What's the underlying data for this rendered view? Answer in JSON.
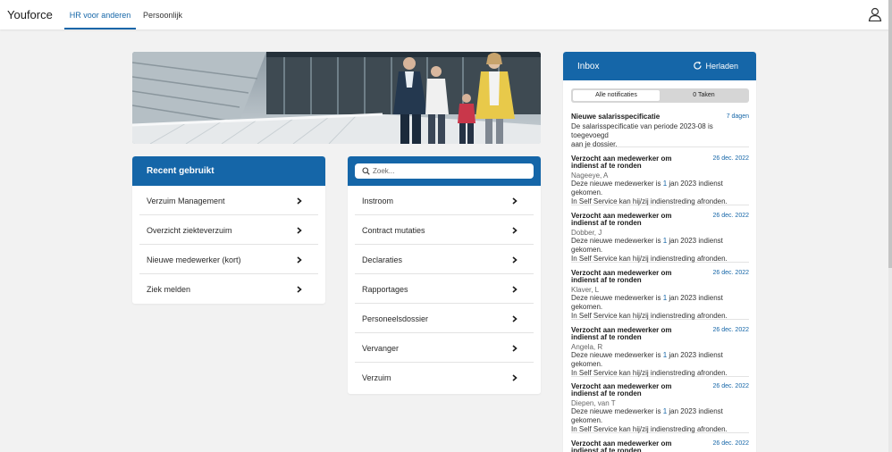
{
  "app": {
    "title": "Youforce"
  },
  "nav": {
    "tabs": [
      {
        "label": "HR voor anderen"
      },
      {
        "label": "Persoonlijk"
      }
    ]
  },
  "recent": {
    "title": "Recent gebruikt",
    "items": [
      {
        "label": "Verzuim Management"
      },
      {
        "label": "Overzicht ziekteverzuim"
      },
      {
        "label": "Nieuwe medewerker (kort)"
      },
      {
        "label": "Ziek melden"
      }
    ]
  },
  "menu": {
    "search_placeholder": "Zoek...",
    "items": [
      {
        "label": "Instroom"
      },
      {
        "label": "Contract mutaties"
      },
      {
        "label": "Declaraties"
      },
      {
        "label": "Rapportages"
      },
      {
        "label": "Personeelsdossier"
      },
      {
        "label": "Vervanger"
      },
      {
        "label": "Verzuim"
      }
    ]
  },
  "inbox": {
    "title": "Inbox",
    "reload_label": "Herladen",
    "tabs": [
      {
        "label": "Alle notificaties"
      },
      {
        "label": "0 Taken"
      }
    ],
    "messages": [
      {
        "title": "Nieuwe salarisspecificatie",
        "date": "7 dagen",
        "line1": "De salarisspecificatie van periode 2023-08 is toegevoegd",
        "line2": "aan je dossier."
      },
      {
        "title": "Verzocht aan medewerker om indienst af te ronden",
        "date": "26 dec. 2022",
        "name": "Nageeye, A",
        "line1a": "Deze nieuwe medewerker is ",
        "line1b": "1",
        "line1c": " jan 2023 indienst gekomen.",
        "line2": "In Self Service kan hij/zij indienstreding afronden."
      },
      {
        "title": "Verzocht aan medewerker om indienst af te ronden",
        "date": "26 dec. 2022",
        "name": "Dobber, J",
        "line1a": "Deze nieuwe medewerker is ",
        "line1b": "1",
        "line1c": " jan 2023 indienst gekomen.",
        "line2": "In Self Service kan hij/zij indienstreding afronden."
      },
      {
        "title": "Verzocht aan medewerker om indienst af te ronden",
        "date": "26 dec. 2022",
        "name": "Klaver, L",
        "line1a": "Deze nieuwe medewerker is ",
        "line1b": "1",
        "line1c": " jan 2023 indienst gekomen.",
        "line2": "In Self Service kan hij/zij indienstreding afronden."
      },
      {
        "title": "Verzocht aan medewerker om indienst af te ronden",
        "date": "26 dec. 2022",
        "name": "Angela, R",
        "line1a": "Deze nieuwe medewerker is ",
        "line1b": "1",
        "line1c": " jan 2023 indienst gekomen.",
        "line2": "In Self Service kan hij/zij indienstreding afronden."
      },
      {
        "title": "Verzocht aan medewerker om indienst af te ronden",
        "date": "26 dec. 2022",
        "name": "Diepen, van T",
        "line1a": "Deze nieuwe medewerker is ",
        "line1b": "1",
        "line1c": " jan 2023 indienst gekomen.",
        "line2": "In Self Service kan hij/zij indienstreding afronden."
      },
      {
        "title": "Verzocht aan medewerker om indienst af te ronden",
        "date": "26 dec. 2022"
      }
    ]
  },
  "colors": {
    "primary": "#1566a8",
    "background": "#f2f2f2"
  },
  "icons": {
    "user": "user-icon",
    "chevron": "chevron-right-icon",
    "search": "search-icon",
    "reload": "reload-icon"
  }
}
